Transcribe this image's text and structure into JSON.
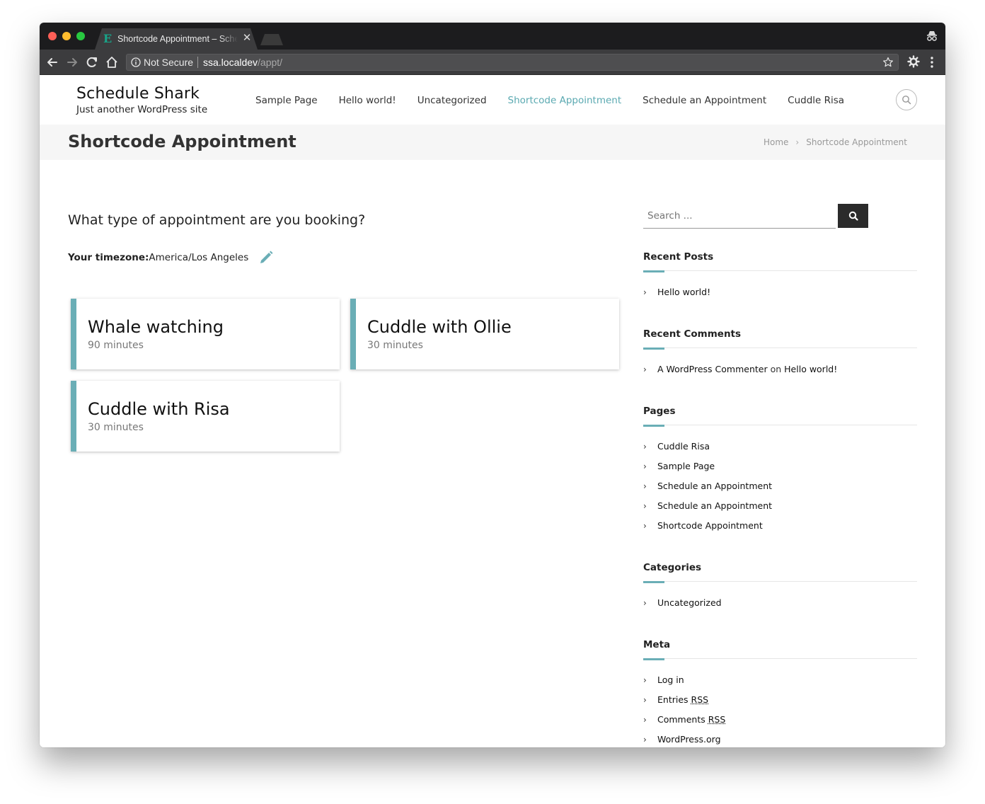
{
  "browser": {
    "tab_title": "Shortcode Appointment – Schedule Shark",
    "tab_favicon": "E",
    "address_secure_label": "Not Secure",
    "address_host": "ssa.localdev",
    "address_path": "/appt/",
    "icons": [
      "back-icon",
      "forward-icon",
      "reload-icon",
      "home-icon",
      "info-icon",
      "star-icon",
      "extension-icon",
      "menu-icon",
      "incognito-icon"
    ]
  },
  "site": {
    "title": "Schedule Shark",
    "tagline": "Just another WordPress site",
    "nav": [
      "Sample Page",
      "Hello world!",
      "Uncategorized",
      "Shortcode Appointment",
      "Schedule an Appointment",
      "Cuddle Risa"
    ],
    "active_nav": "Shortcode Appointment",
    "accent_color": "#6aaeb6"
  },
  "page_header": {
    "title": "Shortcode Appointment",
    "breadcrumb": [
      "Home",
      "Shortcode Appointment"
    ]
  },
  "booking": {
    "question": "What type of appointment are you booking?",
    "timezone_label": "Your timezone:",
    "timezone_value": "America/Los Angeles",
    "appointment_types": [
      {
        "title": "Whale watching",
        "duration": "90 minutes"
      },
      {
        "title": "Cuddle with Ollie",
        "duration": "30 minutes"
      },
      {
        "title": "Cuddle with Risa",
        "duration": "30 minutes"
      }
    ]
  },
  "sidebar": {
    "search_placeholder": "Search ...",
    "recent_posts": {
      "title": "Recent Posts",
      "items": [
        "Hello world!"
      ]
    },
    "recent_comments": {
      "title": "Recent Comments",
      "author": "A WordPress Commenter",
      "on": "on",
      "post": "Hello world!"
    },
    "pages": {
      "title": "Pages",
      "items": [
        "Cuddle Risa",
        "Sample Page",
        "Schedule an Appointment",
        "Schedule an Appointment",
        "Shortcode Appointment"
      ]
    },
    "categories": {
      "title": "Categories",
      "items": [
        "Uncategorized"
      ]
    },
    "meta": {
      "title": "Meta",
      "login": "Log in",
      "entries_prefix": "Entries",
      "comments_prefix": "Comments",
      "rss": "RSS",
      "wordpress_org": "WordPress.org"
    }
  }
}
